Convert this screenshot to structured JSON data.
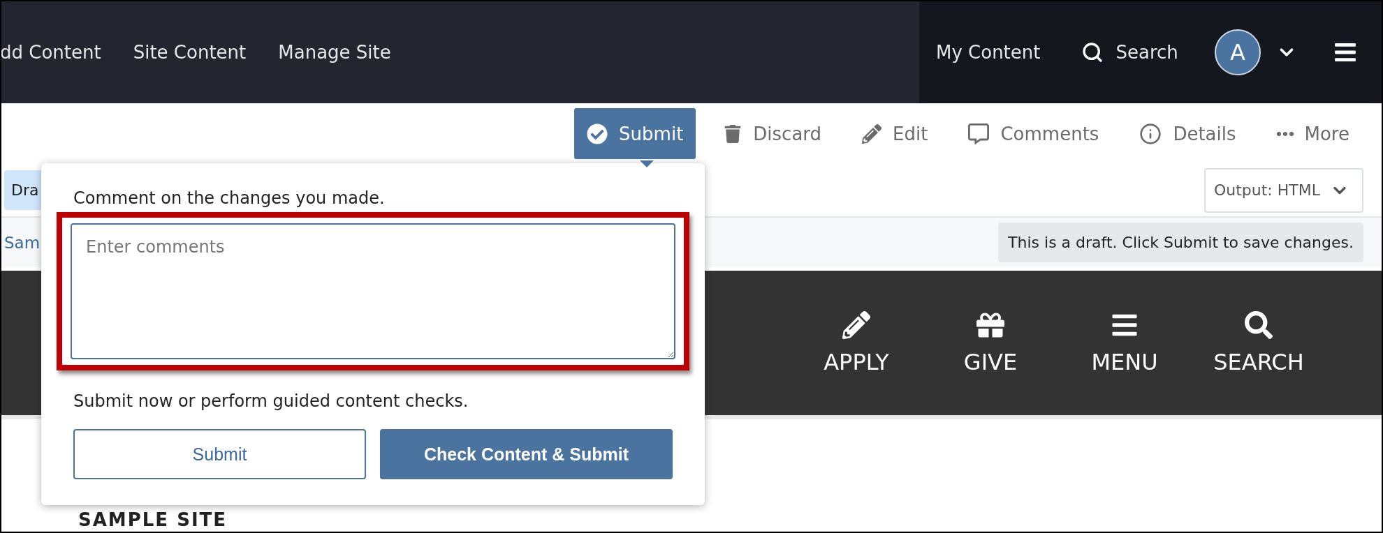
{
  "top_nav": {
    "links": [
      "dd Content",
      "Site Content",
      "Manage Site"
    ],
    "my_content": "My Content",
    "search": "Search",
    "avatar": "A"
  },
  "toolbar": [
    {
      "kind": "submit",
      "label": "Submit",
      "selected": true
    },
    {
      "kind": "discard",
      "label": "Discard",
      "selected": false
    },
    {
      "kind": "edit",
      "label": "Edit",
      "selected": false
    },
    {
      "kind": "comments",
      "label": "Comments",
      "selected": false
    },
    {
      "kind": "details",
      "label": "Details",
      "selected": false
    },
    {
      "kind": "more",
      "label": "More",
      "selected": false
    }
  ],
  "status_badge": "Dra",
  "output_select": "Output: HTML",
  "breadcrumb": "Sam",
  "draft_notice": "This is a draft. Click Submit to save changes.",
  "site_nav": [
    {
      "kind": "apply",
      "label": "APPLY"
    },
    {
      "kind": "give",
      "label": "GIVE"
    },
    {
      "kind": "menu",
      "label": "MENU"
    },
    {
      "kind": "search",
      "label": "SEARCH"
    }
  ],
  "site_title": "SAMPLE SITE",
  "popover": {
    "label": "Comment on the changes you made.",
    "placeholder": "Enter comments",
    "highlighted": true,
    "hint": "Submit now or perform guided content checks.",
    "buttons": [
      {
        "kind": "secondary",
        "label": "Submit"
      },
      {
        "kind": "primary",
        "label": "Check Content & Submit"
      }
    ]
  }
}
